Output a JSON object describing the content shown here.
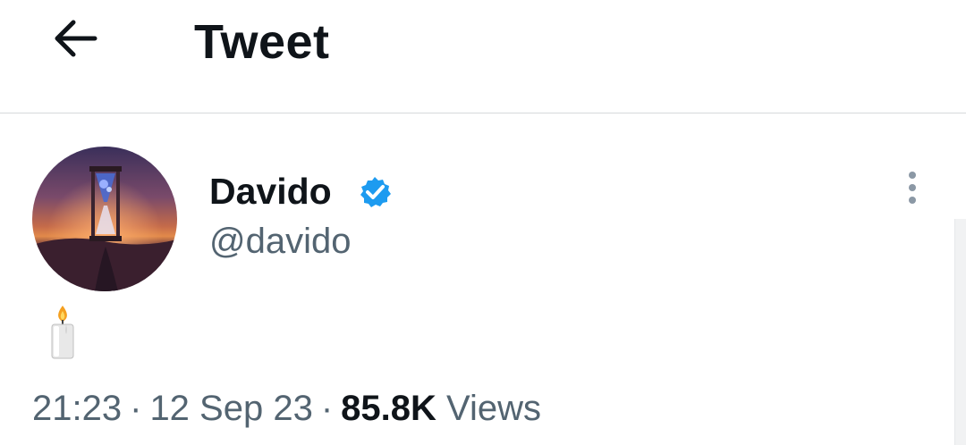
{
  "header": {
    "back_icon": "arrow-left-icon",
    "title": "Tweet"
  },
  "tweet": {
    "author": {
      "display_name": "Davido",
      "handle": "@davido",
      "verified": true,
      "verified_color": "#1d9bf0",
      "avatar": "hourglass-desert-sunset-image"
    },
    "more_icon": "more-vertical-icon",
    "content": {
      "emoji": "candle-emoji"
    },
    "meta": {
      "time": "21:23",
      "separator": "·",
      "date": "12 Sep 23",
      "views_count": "85.8K",
      "views_label": "Views"
    }
  },
  "colors": {
    "text_primary": "#0f1419",
    "text_secondary": "#536471",
    "divider": "#d6d9db"
  }
}
